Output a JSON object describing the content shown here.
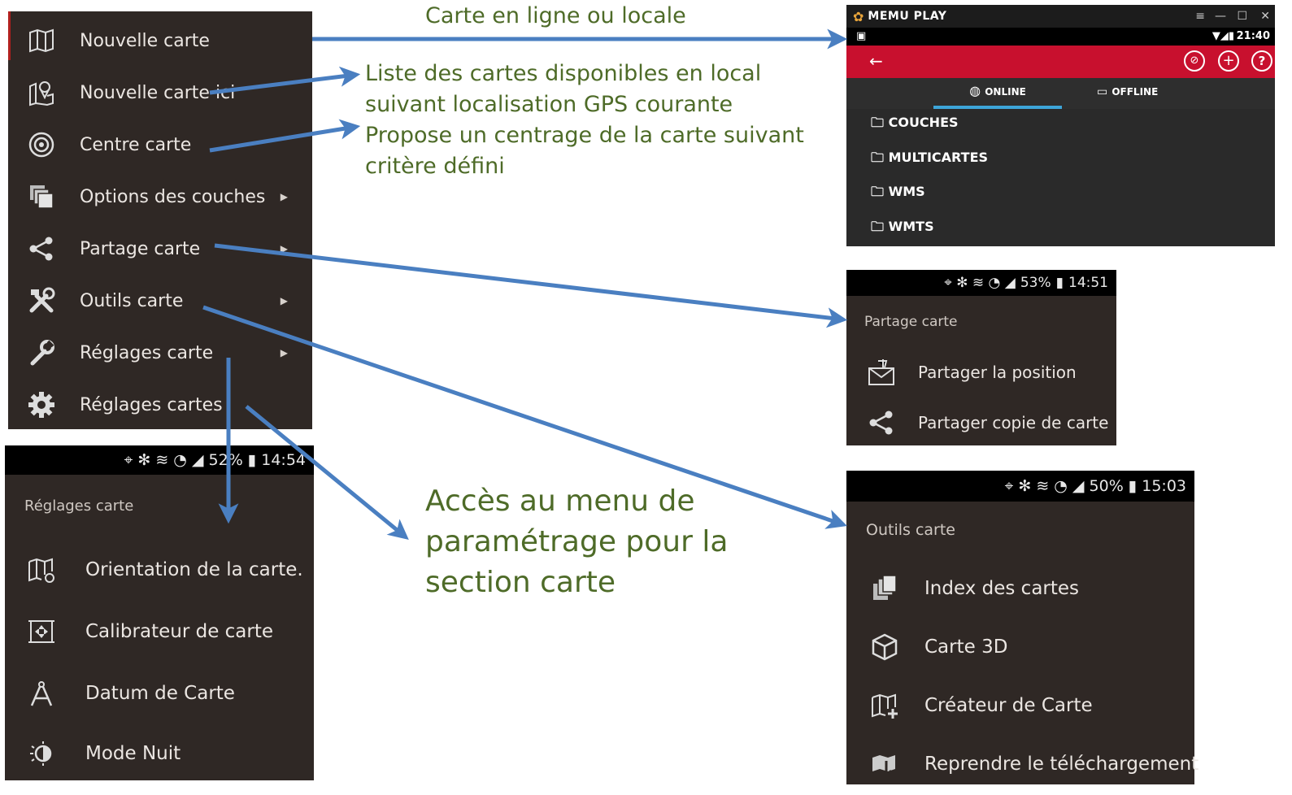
{
  "main_menu": {
    "items": [
      {
        "label": "Nouvelle carte",
        "icon": "map-icon",
        "submenu": false
      },
      {
        "label": "Nouvelle carte ici",
        "icon": "map-pin-icon",
        "submenu": false
      },
      {
        "label": "Centre carte",
        "icon": "target-icon",
        "submenu": false
      },
      {
        "label": "Options des couches",
        "icon": "layers-icon",
        "submenu": true
      },
      {
        "label": "Partage carte",
        "icon": "share-icon",
        "submenu": true
      },
      {
        "label": "Outils carte",
        "icon": "tools-icon",
        "submenu": true
      },
      {
        "label": "Réglages carte",
        "icon": "wrench-icon",
        "submenu": true
      },
      {
        "label": "Réglages cartes",
        "icon": "gear-icon",
        "submenu": false
      }
    ]
  },
  "annotations": {
    "online_local": "Carte en ligne ou locale",
    "local_list_line1": "Liste des cartes disponibles en local",
    "local_list_line2": "suivant  localisation GPS courante",
    "center_line1": "Propose un centrage de la carte suivant",
    "center_line2": "critère défini",
    "settings_line1": "Accès au menu de",
    "settings_line2": "paramétrage pour la",
    "settings_line3": "section carte"
  },
  "memu": {
    "app_title": "MEMU PLAY",
    "time": "21:40",
    "tabs": [
      "ONLINE",
      "OFFLINE"
    ],
    "active_tab": "ONLINE",
    "folders": [
      "COUCHES",
      "MULTICARTES",
      "WMS",
      "WMTS"
    ],
    "accent": "#c8102e"
  },
  "share_panel": {
    "status": {
      "battery": "53%",
      "time": "14:51"
    },
    "title": "Partage carte",
    "items": [
      {
        "label": "Partager la position",
        "icon": "envelope-pin-icon"
      },
      {
        "label": "Partager copie de carte",
        "icon": "share-icon"
      }
    ]
  },
  "settings_panel": {
    "status": {
      "battery": "52%",
      "time": "14:54"
    },
    "title": "Réglages carte",
    "items": [
      {
        "label": "Orientation de la carte.",
        "icon": "map-rotate-icon"
      },
      {
        "label": "Calibrateur de carte",
        "icon": "calibrate-icon"
      },
      {
        "label": "Datum de Carte",
        "icon": "compass-icon"
      },
      {
        "label": "Mode Nuit",
        "icon": "night-mode-icon"
      }
    ]
  },
  "tools_panel": {
    "status": {
      "battery": "50%",
      "time": "15:03"
    },
    "title": "Outils carte",
    "items": [
      {
        "label": "Index des cartes",
        "icon": "map-index-icon"
      },
      {
        "label": "Carte 3D",
        "icon": "cube-icon"
      },
      {
        "label": "Créateur de Carte",
        "icon": "map-add-icon"
      },
      {
        "label": "Reprendre le téléchargement",
        "icon": "download-resume-icon"
      }
    ]
  },
  "colors": {
    "annotation": "#4e6b28",
    "arrow": "#4a7fc1",
    "panel": "#2f2825"
  }
}
